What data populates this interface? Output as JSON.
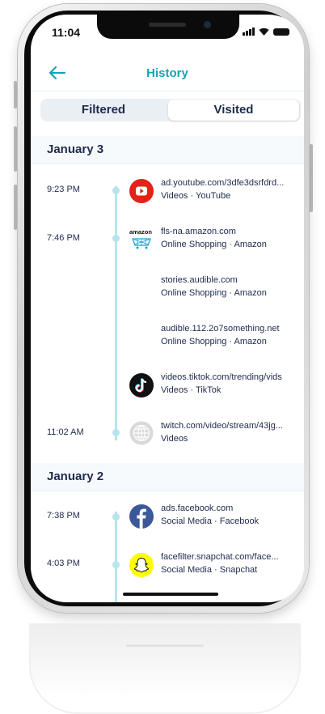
{
  "status_bar": {
    "time": "11:04"
  },
  "header": {
    "title": "History",
    "back_icon": "arrow-left-icon"
  },
  "tabs": {
    "filtered_label": "Filtered",
    "visited_label": "Visited",
    "selected": "Visited"
  },
  "sections": [
    {
      "date": "January 3",
      "entries": [
        {
          "time": "9:23 PM",
          "url": "ad.youtube.com/3dfe3dsrfdrd...",
          "category": "Videos · YouTube",
          "icon": "youtube-icon"
        },
        {
          "time": "7:46 PM",
          "url": "fls-na.amazon.com",
          "category": "Online Shopping · Amazon",
          "icon": "amazon-icon",
          "icon_text": "amazon"
        },
        {
          "time": "",
          "url": "stories.audible.com",
          "category": "Online Shopping · Amazon",
          "icon": ""
        },
        {
          "time": "",
          "url": "audible.112.2o7something.net",
          "category": "Online Shopping · Amazon",
          "icon": ""
        },
        {
          "time": "",
          "url": "videos.tiktok.com/trending/vids",
          "category": "Videos · TikTok",
          "icon": "tiktok-icon"
        },
        {
          "time": "11:02 AM",
          "url": "twitch.com/video/stream/43jg...",
          "category": "Videos",
          "icon": "globe-icon"
        }
      ]
    },
    {
      "date": "January 2",
      "entries": [
        {
          "time": "7:38 PM",
          "url": "ads.facebook.com",
          "category": "Social Media · Facebook",
          "icon": "facebook-icon"
        },
        {
          "time": "4:03 PM",
          "url": "facefilter.snapchat.com/face...",
          "category": "Social Media · Snapchat",
          "icon": "snapchat-icon"
        }
      ]
    }
  ],
  "colors": {
    "accent": "#16a3b8",
    "text": "#1f2a4d",
    "timeline": "#b8e4ee"
  }
}
